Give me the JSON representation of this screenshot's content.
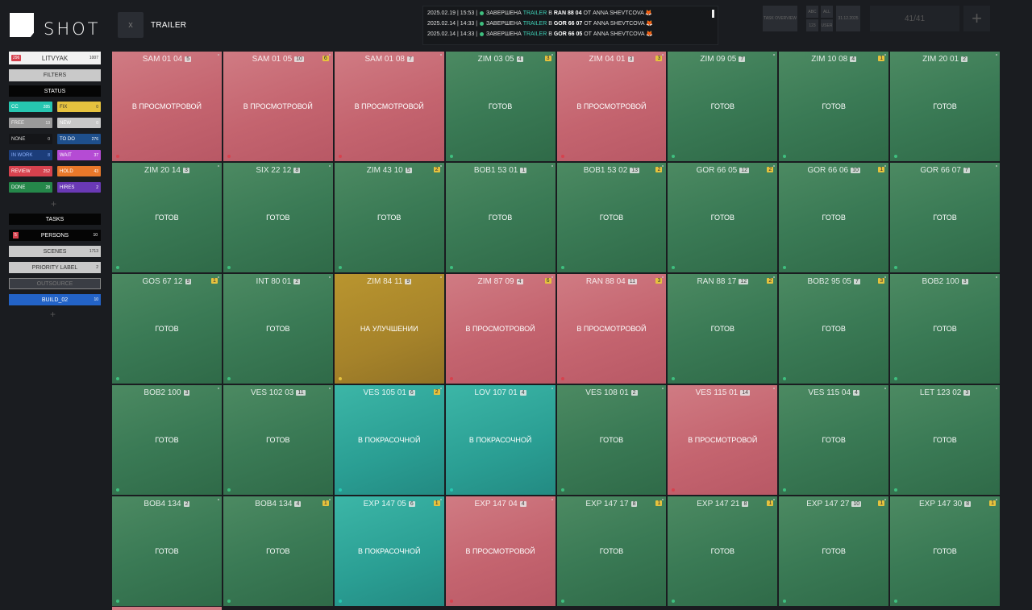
{
  "logo": {
    "text": "SHOT"
  },
  "header": {
    "back_button": "x",
    "title": "TRAILER",
    "counter": "41/41",
    "plus": "+",
    "buttons": {
      "task_overview": "TASK OVERVIEW",
      "abc": "ABC",
      "all": "ALL",
      "num": "123",
      "user": "USER",
      "date": "31.12.2025"
    }
  },
  "log": [
    {
      "time": "2025.02.19 | 15:53 |",
      "action": "ЗАВЕРШЕНА",
      "tag": "TRAILER",
      "prep": "В",
      "shot": "RAN 88 04",
      "by": "ОТ ANNA SHEVTCOVA"
    },
    {
      "time": "2025.02.14 | 14:33 |",
      "action": "ЗАВЕРШЕНА",
      "tag": "TRAILER",
      "prep": "В",
      "shot": "GOR 66 07",
      "by": "ОТ ANNA SHEVTCOVA"
    },
    {
      "time": "2025.02.14 | 14:33 |",
      "action": "ЗАВЕРШЕНА",
      "tag": "TRAILER",
      "prep": "В",
      "shot": "GOR 66 05",
      "by": "ОТ ANNA SHEVTCOVA"
    }
  ],
  "sidebar": {
    "project": {
      "badge": "296",
      "name": "LITVYAK",
      "count": "1007"
    },
    "filters": "FILTERS",
    "status": "STATUS",
    "statuses": [
      {
        "label": "CC",
        "count": "285",
        "bg": "#26c6b0",
        "fg": "#fff"
      },
      {
        "label": "FIX",
        "count": "0",
        "bg": "#e6c23e",
        "fg": "#333"
      },
      {
        "label": "FREE",
        "count": "13",
        "bg": "#9a9a9a",
        "fg": "#eee"
      },
      {
        "label": "NEW",
        "count": "0",
        "bg": "#c8c8c8",
        "fg": "#fff"
      },
      {
        "label": "NONE",
        "count": "0",
        "bg": "#141518",
        "fg": "#ddd"
      },
      {
        "label": "TO DO",
        "count": "276",
        "bg": "#1e4f8c",
        "fg": "#fff"
      },
      {
        "label": "IN WORK",
        "count": "8",
        "bg": "#1c3d7a",
        "fg": "#8fb4ff"
      },
      {
        "label": "WAIT",
        "count": "37",
        "bg": "#b54bd4",
        "fg": "#fff"
      },
      {
        "label": "REVIEW",
        "count": "252",
        "bg": "#d6424e",
        "fg": "#fff"
      },
      {
        "label": "HOLD",
        "count": "43",
        "bg": "#e8782a",
        "fg": "#fff"
      },
      {
        "label": "DONE",
        "count": "28",
        "bg": "#25874a",
        "fg": "#fff"
      },
      {
        "label": "HIRES",
        "count": "2",
        "bg": "#6a39b5",
        "fg": "#fff"
      }
    ],
    "status_add": "+",
    "tasks": "TASKS",
    "persons": {
      "badge": "5",
      "label": "PERSONS",
      "count": "10"
    },
    "scenes": {
      "label": "SCENES",
      "count": "1713"
    },
    "priority": {
      "label": "PRIORITY LABEL",
      "count": "2"
    },
    "outsource": "OUTSOURCE",
    "build": {
      "label": "BUILD_02",
      "count": "10"
    },
    "add": "+"
  },
  "status_colors": {
    "green": "#3a7a55",
    "red": "#c4646f",
    "teal": "#2a9e93",
    "gold": "#a6832a"
  },
  "shots": [
    {
      "name": "SAM 01 04",
      "count": "5",
      "ver": "",
      "status": "В ПРОСМОТРОВОЙ",
      "c": "red",
      "dot": "#d6424e"
    },
    {
      "name": "SAM 01 05",
      "count": "10",
      "ver": "6",
      "status": "В ПРОСМОТРОВОЙ",
      "c": "red",
      "dot": "#d6424e"
    },
    {
      "name": "SAM 01 08",
      "count": "7",
      "ver": "",
      "status": "В ПРОСМОТРОВОЙ",
      "c": "red",
      "dot": "#d6424e"
    },
    {
      "name": "ZIM 03 05",
      "count": "4",
      "ver": "3",
      "status": "ГОТОВ",
      "c": "green",
      "dot": "#3fbf7f"
    },
    {
      "name": "ZIM 04 01",
      "count": "3",
      "ver": "3",
      "status": "В ПРОСМОТРОВОЙ",
      "c": "red",
      "dot": "#d6424e"
    },
    {
      "name": "ZIM 09 05",
      "count": "7",
      "ver": "",
      "status": "ГОТОВ",
      "c": "green",
      "dot": "#3fbf7f"
    },
    {
      "name": "ZIM 10 08",
      "count": "4",
      "ver": "1",
      "status": "ГОТОВ",
      "c": "green",
      "dot": "#3fbf7f"
    },
    {
      "name": "ZIM 20 01",
      "count": "2",
      "ver": "",
      "status": "ГОТОВ",
      "c": "green",
      "dot": "#3fbf7f"
    },
    {
      "name": "ZIM 20 14",
      "count": "3",
      "ver": "",
      "status": "ГОТОВ",
      "c": "green",
      "dot": "#3fbf7f"
    },
    {
      "name": "SIX 22 12",
      "count": "8",
      "ver": "",
      "status": "ГОТОВ",
      "c": "green",
      "dot": "#3fbf7f"
    },
    {
      "name": "ZIM 43 10",
      "count": "5",
      "ver": "2",
      "status": "ГОТОВ",
      "c": "green",
      "dot": "#3fbf7f"
    },
    {
      "name": "BOB1 53 01",
      "count": "1",
      "ver": "",
      "status": "ГОТОВ",
      "c": "green",
      "dot": "#3fbf7f"
    },
    {
      "name": "BOB1 53 02",
      "count": "13",
      "ver": "2",
      "status": "ГОТОВ",
      "c": "green",
      "dot": "#3fbf7f"
    },
    {
      "name": "GOR 66 05",
      "count": "12",
      "ver": "2",
      "status": "ГОТОВ",
      "c": "green",
      "dot": "#3fbf7f"
    },
    {
      "name": "GOR 66 06",
      "count": "10",
      "ver": "1",
      "status": "ГОТОВ",
      "c": "green",
      "dot": "#3fbf7f"
    },
    {
      "name": "GOR 66 07",
      "count": "7",
      "ver": "",
      "status": "ГОТОВ",
      "c": "green",
      "dot": "#3fbf7f"
    },
    {
      "name": "GOS 67 12",
      "count": "9",
      "ver": "1",
      "status": "ГОТОВ",
      "c": "green",
      "dot": "#3fbf7f"
    },
    {
      "name": "INT 80 01",
      "count": "2",
      "ver": "",
      "status": "ГОТОВ",
      "c": "green",
      "dot": "#3fbf7f"
    },
    {
      "name": "ZIM 84 11",
      "count": "9",
      "ver": "",
      "status": "НА УЛУЧШЕНИИ",
      "c": "gold",
      "dot": "#e6c23e"
    },
    {
      "name": "ZIM 87 09",
      "count": "4",
      "ver": "6",
      "status": "В ПРОСМОТРОВОЙ",
      "c": "red",
      "dot": "#d6424e"
    },
    {
      "name": "RAN 88 04",
      "count": "11",
      "ver": "3",
      "status": "В ПРОСМОТРОВОЙ",
      "c": "red",
      "dot": "#d6424e"
    },
    {
      "name": "RAN 88 17",
      "count": "12",
      "ver": "2",
      "status": "ГОТОВ",
      "c": "green",
      "dot": "#3fbf7f"
    },
    {
      "name": "BOB2 95 05",
      "count": "7",
      "ver": "3",
      "status": "ГОТОВ",
      "c": "green",
      "dot": "#3fbf7f"
    },
    {
      "name": "BOB2 100",
      "count": "3",
      "ver": "",
      "status": "ГОТОВ",
      "c": "green",
      "dot": "#3fbf7f"
    },
    {
      "name": "BOB2 100",
      "count": "3",
      "ver": "",
      "status": "ГОТОВ",
      "c": "green",
      "dot": "#3fbf7f"
    },
    {
      "name": "VES 102 03",
      "count": "11",
      "ver": "",
      "status": "ГОТОВ",
      "c": "green",
      "dot": "#3fbf7f"
    },
    {
      "name": "VES 105 01",
      "count": "6",
      "ver": "2",
      "status": "В ПОКРАСОЧНОЙ",
      "c": "teal",
      "dot": "#26c6b0"
    },
    {
      "name": "LOV 107 01",
      "count": "4",
      "ver": "",
      "status": "В ПОКРАСОЧНОЙ",
      "c": "teal",
      "dot": "#26c6b0"
    },
    {
      "name": "VES 108 01",
      "count": "2",
      "ver": "",
      "status": "ГОТОВ",
      "c": "green",
      "dot": "#3fbf7f"
    },
    {
      "name": "VES 115 01",
      "count": "14",
      "ver": "",
      "status": "В ПРОСМОТРОВОЙ",
      "c": "red",
      "dot": "#d6424e"
    },
    {
      "name": "VES 115 04",
      "count": "4",
      "ver": "",
      "status": "ГОТОВ",
      "c": "green",
      "dot": "#3fbf7f"
    },
    {
      "name": "LET 123 02",
      "count": "3",
      "ver": "",
      "status": "ГОТОВ",
      "c": "green",
      "dot": "#3fbf7f"
    },
    {
      "name": "BOB4 134",
      "count": "2",
      "ver": "",
      "status": "ГОТОВ",
      "c": "green",
      "dot": "#3fbf7f"
    },
    {
      "name": "BOB4 134",
      "count": "4",
      "ver": "1",
      "status": "ГОТОВ",
      "c": "green",
      "dot": "#3fbf7f"
    },
    {
      "name": "EXP 147 05",
      "count": "6",
      "ver": "1",
      "status": "В ПОКРАСОЧНОЙ",
      "c": "teal",
      "dot": "#26c6b0"
    },
    {
      "name": "EXP 147 04",
      "count": "4",
      "ver": "",
      "status": "В ПРОСМОТРОВОЙ",
      "c": "red",
      "dot": "#d6424e"
    },
    {
      "name": "EXP 147 17",
      "count": "8",
      "ver": "1",
      "status": "ГОТОВ",
      "c": "green",
      "dot": "#3fbf7f"
    },
    {
      "name": "EXP 147 21",
      "count": "8",
      "ver": "1",
      "status": "ГОТОВ",
      "c": "green",
      "dot": "#3fbf7f"
    },
    {
      "name": "EXP 147 27",
      "count": "10",
      "ver": "1",
      "status": "ГОТОВ",
      "c": "green",
      "dot": "#3fbf7f"
    },
    {
      "name": "EXP 147 30",
      "count": "8",
      "ver": "1",
      "status": "ГОТОВ",
      "c": "green",
      "dot": "#3fbf7f"
    }
  ]
}
